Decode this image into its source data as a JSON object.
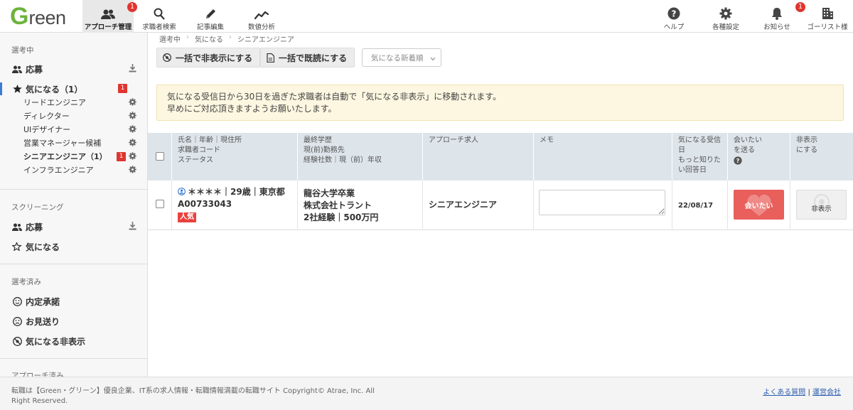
{
  "logo": {
    "first": "G",
    "rest": "reen"
  },
  "nav": {
    "approach": {
      "label": "アプローチ管理",
      "badge": "1"
    },
    "search": {
      "label": "求職者検索"
    },
    "article": {
      "label": "記事編集"
    },
    "analytics": {
      "label": "数値分析"
    },
    "help": {
      "label": "ヘルプ"
    },
    "settings": {
      "label": "各種設定"
    },
    "notices": {
      "label": "お知らせ",
      "badge": "1"
    },
    "company": {
      "label": "ゴーリスト様"
    }
  },
  "sidebar": {
    "section1": "選考中",
    "apply": "応募",
    "interested": "気になる（1）",
    "interested_badge": "1",
    "subs": [
      {
        "label": "リードエンジニア"
      },
      {
        "label": "ディレクター"
      },
      {
        "label": "UIデザイナー"
      },
      {
        "label": "営業マネージャー候補"
      },
      {
        "label": "シニアエンジニア（1）",
        "badge": "1"
      },
      {
        "label": "インフラエンジニア"
      }
    ],
    "section2": "スクリーニング",
    "scr_apply": "応募",
    "scr_interested": "気になる",
    "section3": "選考済み",
    "offer": "内定承諾",
    "decline": "お見送り",
    "hidden": "気になる非表示",
    "section4": "アプローチ済み"
  },
  "breadcrumb": [
    "選考中",
    "気になる",
    "シニアエンジニア"
  ],
  "toolbar": {
    "hide_all": "一括で非表示にする",
    "read_all": "一括で既読にする",
    "sort_selected": "気になる新着順"
  },
  "notice": {
    "line1": "気になる受信日から30日を過ぎた求職者は自動で「気になる非表示」に移動されます。",
    "line2": "早めにご対応頂きますようお願いたします。"
  },
  "table": {
    "headers": {
      "col1": [
        "氏名｜年齢｜現住所",
        "求職者コード",
        "ステータス"
      ],
      "col2": [
        "最終学歴",
        "現(前)勤務先",
        "経験社数｜現（前）年収"
      ],
      "col3": [
        "アプローチ求人"
      ],
      "col4": [
        "メモ"
      ],
      "col5": [
        "気になる受信",
        "日",
        "もっと知りた",
        "い回答日"
      ],
      "col6": [
        "会いたい",
        "を送る"
      ],
      "col7": [
        "非表示",
        "にする"
      ]
    },
    "rows": [
      {
        "name_line": "＊＊＊＊｜29歳｜東京都",
        "code": "A00733043",
        "tag": "人気",
        "edu": "龍谷大学卒業",
        "company": "株式会社トラント",
        "exp": "2社経験｜500万円",
        "job": "シニアエンジニア",
        "memo": "",
        "date": "22/08/17",
        "want_label": "会いたい",
        "hide_label": "非表示"
      }
    ]
  },
  "footer": {
    "copyright": "転職は【Green・グリーン】優良企業、IT系の求人情報・転職情報満載の転職サイト Copyright© Atrae, Inc. All Right Reserved.",
    "faq": "よくある質問",
    "company": "運営会社"
  },
  "colors": {
    "brand_green": "#6cb33e",
    "badge_red": "#e0352f",
    "want_button": "#e85f5c"
  }
}
